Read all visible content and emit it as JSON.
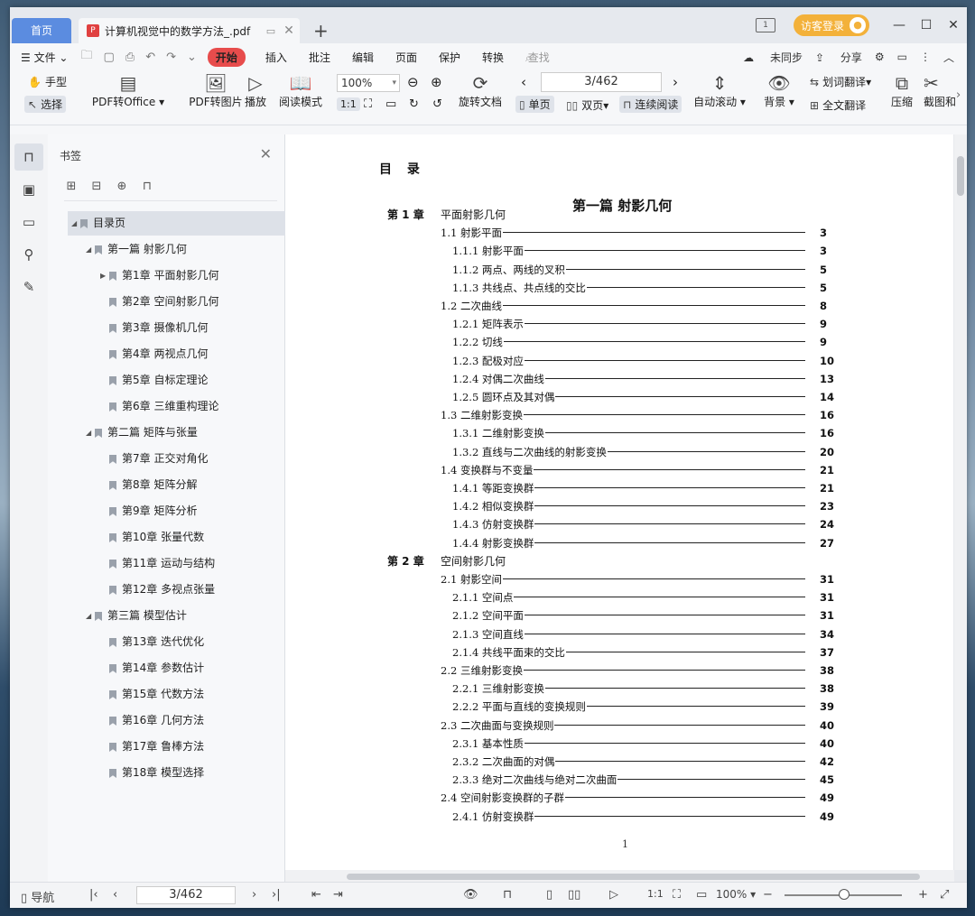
{
  "titlebar": {
    "home_tab": "首页",
    "doc_tab": "计算机视觉中的数学方法_.pdf",
    "login": "访客登录",
    "badge": "1"
  },
  "menu": {
    "file": "文件",
    "start": "开始",
    "items": [
      "插入",
      "批注",
      "编辑",
      "页面",
      "保护",
      "转换"
    ],
    "search": "查找",
    "sync": "未同步",
    "share": "分享"
  },
  "ribbon": {
    "hand": "手型",
    "select": "选择",
    "pdf_to_office": "PDF转Office",
    "pdf_to_image": "PDF转图片",
    "play": "播放",
    "read_mode": "阅读模式",
    "zoom": "100%",
    "rotate": "旋转文档",
    "page": "3/462",
    "single": "单页",
    "double": "双页",
    "continuous": "连续阅读",
    "auto_scroll": "自动滚动",
    "background": "背景",
    "word_translate": "划词翻译",
    "full_translate": "全文翻译",
    "compress": "压缩",
    "screenshot": "截图和"
  },
  "sidebar": {
    "title": "书签",
    "items": [
      {
        "label": "目录页",
        "level": 0,
        "expand": "down",
        "selected": true
      },
      {
        "label": "第一篇 射影几何",
        "level": 1,
        "expand": "down"
      },
      {
        "label": "第1章   平面射影几何",
        "level": 2,
        "expand": "right"
      },
      {
        "label": "第2章   空间射影几何",
        "level": 2
      },
      {
        "label": "第3章   摄像机几何",
        "level": 2
      },
      {
        "label": "第4章   两视点几何",
        "level": 2
      },
      {
        "label": "第5章   自标定理论",
        "level": 2
      },
      {
        "label": "第6章   三维重构理论",
        "level": 2
      },
      {
        "label": "第二篇 矩阵与张量",
        "level": 1,
        "expand": "down"
      },
      {
        "label": "第7章   正交对角化",
        "level": 2
      },
      {
        "label": "第8章   矩阵分解",
        "level": 2
      },
      {
        "label": "第9章   矩阵分析",
        "level": 2
      },
      {
        "label": "第10章   张量代数",
        "level": 2
      },
      {
        "label": "第11章   运动与结构",
        "level": 2
      },
      {
        "label": "第12章   多视点张量",
        "level": 2
      },
      {
        "label": "第三篇 模型估计",
        "level": 1,
        "expand": "down"
      },
      {
        "label": "第13章   迭代优化",
        "level": 2
      },
      {
        "label": "第14章   参数估计",
        "level": 2
      },
      {
        "label": "第15章   代数方法",
        "level": 2
      },
      {
        "label": "第16章   几何方法",
        "level": 2
      },
      {
        "label": "第17章   鲁棒方法",
        "level": 2
      },
      {
        "label": "第18章   模型选择",
        "level": 2
      }
    ]
  },
  "document": {
    "toc_heading": "目 录",
    "part_title": "第一篇  射影几何",
    "page_number": "1",
    "lines": [
      {
        "kind": "chapter",
        "num": "第 1 章",
        "title": "平面射影几何"
      },
      {
        "kind": "sec",
        "text": "1.1 射影平面",
        "page": "3"
      },
      {
        "kind": "sub",
        "text": "1.1.1 射影平面",
        "page": "3"
      },
      {
        "kind": "sub",
        "text": "1.1.2  两点、两线的叉积",
        "page": "5"
      },
      {
        "kind": "sub",
        "text": "1.1.3 共线点、共点线的交比",
        "page": "5"
      },
      {
        "kind": "sec",
        "text": "1.2  二次曲线",
        "page": "8"
      },
      {
        "kind": "sub",
        "text": "1.2.1    矩阵表示",
        "page": "9"
      },
      {
        "kind": "sub",
        "text": "1.2.2    切线",
        "page": "9"
      },
      {
        "kind": "sub",
        "text": "1.2.3    配极对应",
        "page": "10"
      },
      {
        "kind": "sub",
        "text": "1.2.4    对偶二次曲线",
        "page": "13"
      },
      {
        "kind": "sub",
        "text": "1.2.5    圆环点及其对偶",
        "page": "14"
      },
      {
        "kind": "sec",
        "text": "1.3    二维射影变换",
        "page": "16"
      },
      {
        "kind": "sub",
        "text": "1.3.1    二维射影变换",
        "page": "16"
      },
      {
        "kind": "sub",
        "text": "1.3.2    直线与二次曲线的射影变换",
        "page": "20"
      },
      {
        "kind": "sec",
        "text": "1.4    变换群与不变量",
        "page": "21"
      },
      {
        "kind": "sub",
        "text": "1.4.1    等距变换群",
        "page": "21"
      },
      {
        "kind": "sub",
        "text": "1.4.2    相似变换群",
        "page": "23"
      },
      {
        "kind": "sub",
        "text": "1.4.3    仿射变换群",
        "page": "24"
      },
      {
        "kind": "sub",
        "text": "1.4.4    射影变换群",
        "page": "27"
      },
      {
        "kind": "chapter",
        "num": "第 2 章",
        "title": "空间射影几何"
      },
      {
        "kind": "sec",
        "text": "2.1    射影空间",
        "page": "31"
      },
      {
        "kind": "sub",
        "text": "2.1.1    空间点",
        "page": "31"
      },
      {
        "kind": "sub",
        "text": "2.1.2    空间平面",
        "page": "31"
      },
      {
        "kind": "sub",
        "text": "2.1.3    空间直线",
        "page": "34"
      },
      {
        "kind": "sub",
        "text": "2.1.4    共线平面束的交比",
        "page": "37"
      },
      {
        "kind": "sec",
        "text": "2.2    三维射影变换",
        "page": "38"
      },
      {
        "kind": "sub",
        "text": "2.2.1    三维射影变换",
        "page": "38"
      },
      {
        "kind": "sub",
        "text": "2.2.2    平面与直线的变换规则",
        "page": "39"
      },
      {
        "kind": "sec",
        "text": "2.3    二次曲面与变换规则",
        "page": "40"
      },
      {
        "kind": "sub",
        "text": "2.3.1    基本性质",
        "page": "40"
      },
      {
        "kind": "sub",
        "text": "2.3.2    二次曲面的对偶",
        "page": "42"
      },
      {
        "kind": "sub",
        "text": "2.3.3    绝对二次曲线与绝对二次曲面",
        "page": "45"
      },
      {
        "kind": "sec",
        "text": "2.4    空间射影变换群的子群",
        "page": "49"
      },
      {
        "kind": "sub",
        "text": "2.4.1    仿射变换群",
        "page": "49"
      }
    ]
  },
  "status": {
    "nav": "导航",
    "page": "3/462",
    "zoom": "100%"
  }
}
